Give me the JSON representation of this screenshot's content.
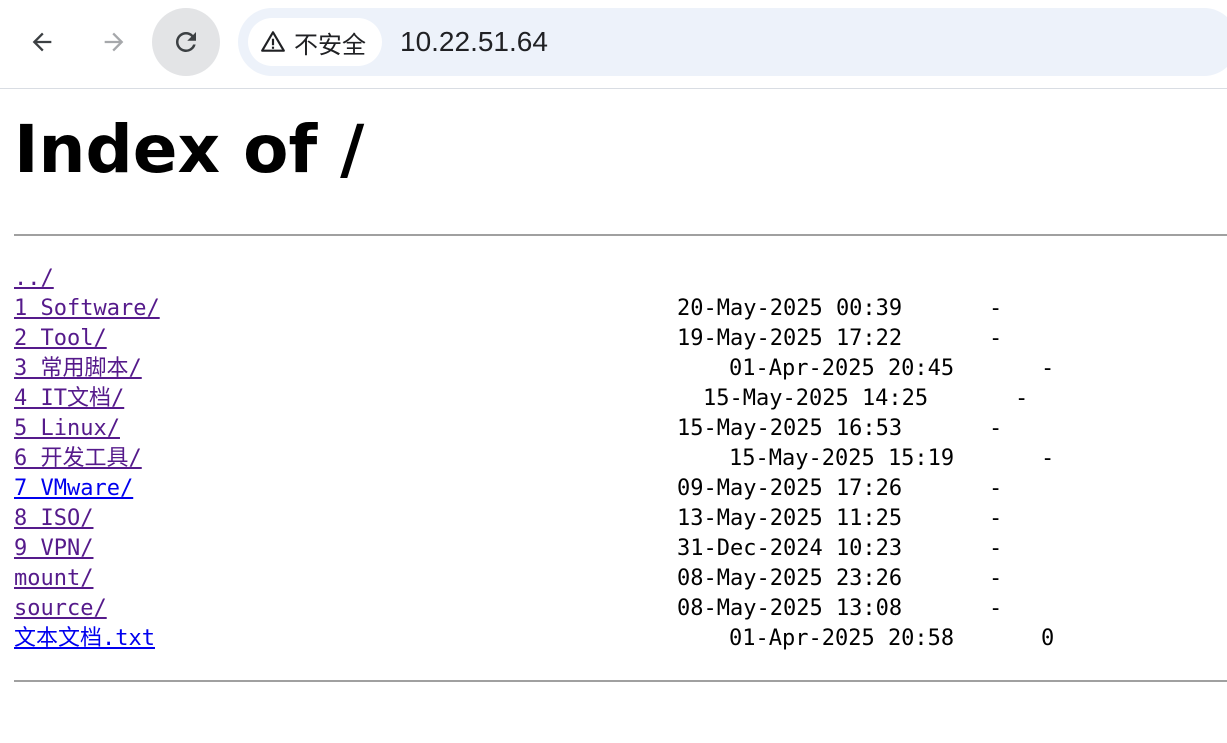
{
  "browser": {
    "security_label": "不安全",
    "url": "10.22.51.64",
    "icons": {
      "back": "back-arrow-icon",
      "forward": "forward-arrow-icon",
      "reload": "reload-icon",
      "security": "warning-triangle-icon"
    }
  },
  "page": {
    "title": "Index of /",
    "entries": [
      {
        "name": "../",
        "date": "",
        "size": ""
      },
      {
        "name": "1 Software/",
        "date": "20-May-2025 00:39",
        "size": "-"
      },
      {
        "name": "2 Tool/",
        "date": "19-May-2025 17:22",
        "size": "-"
      },
      {
        "name": "3 常用脚本/",
        "date": "01-Apr-2025 20:45",
        "size": "-"
      },
      {
        "name": "4 IT文档/",
        "date": "15-May-2025 14:25",
        "size": "-"
      },
      {
        "name": "5 Linux/",
        "date": "15-May-2025 16:53",
        "size": "-"
      },
      {
        "name": "6 开发工具/",
        "date": "15-May-2025 15:19",
        "size": "-"
      },
      {
        "name": "7 VMware/",
        "date": "09-May-2025 17:26",
        "size": "-"
      },
      {
        "name": "8 ISO/",
        "date": "13-May-2025 11:25",
        "size": "-"
      },
      {
        "name": "9 VPN/",
        "date": "31-Dec-2024 10:23",
        "size": "-"
      },
      {
        "name": "mount/",
        "date": "08-May-2025 23:26",
        "size": "-"
      },
      {
        "name": "source/",
        "date": "08-May-2025 13:08",
        "size": "-"
      },
      {
        "name": "文本文档.txt",
        "date": "01-Apr-2025 20:58",
        "size": "0"
      }
    ]
  },
  "colors": {
    "visited_link": "#551a8b",
    "unvisited_link": "#0000ee",
    "omnibox_bg": "#edf2fa",
    "rule": "#a0a0a0"
  }
}
